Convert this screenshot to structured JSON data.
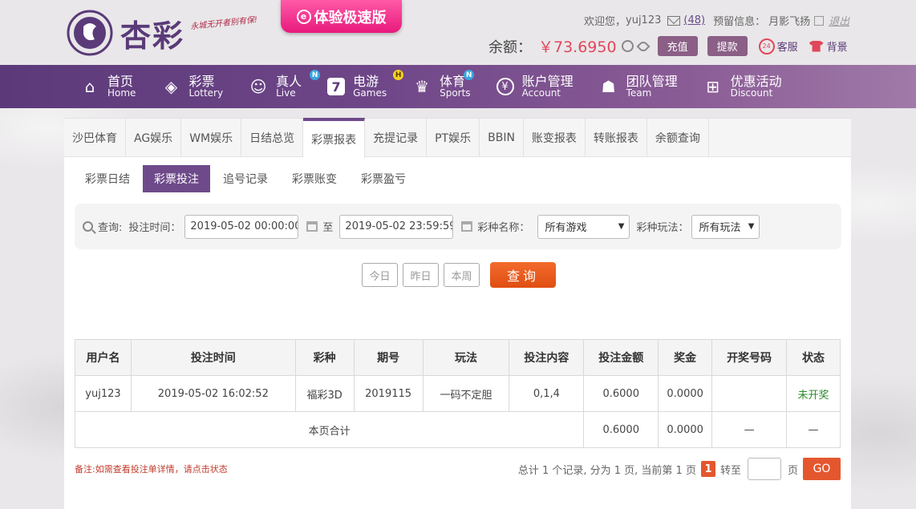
{
  "header": {
    "logo_text": "杏彩",
    "logo_slogan": "永城无开者别有保!",
    "speed_badge": "体验极速版",
    "welcome": "欢迎您，",
    "username": "yuj123",
    "message_count": "(48)",
    "reserve_label": "预留信息：",
    "reserve_value": "月影飞扬",
    "logout": "退出",
    "balance_label": "余额：",
    "balance_value": "￥73.6950",
    "recharge": "充值",
    "withdraw": "提款",
    "service": "客服",
    "background": "背景"
  },
  "nav": [
    {
      "cn": "首页",
      "en": "Home",
      "icon": "home-icon",
      "badge": ""
    },
    {
      "cn": "彩票",
      "en": "Lottery",
      "icon": "lottery-icon",
      "badge": ""
    },
    {
      "cn": "真人",
      "en": "Live",
      "icon": "live-dealer-icon",
      "badge": "N"
    },
    {
      "cn": "电游",
      "en": "Games",
      "icon": "slot-seven-icon",
      "badge": "H"
    },
    {
      "cn": "体育",
      "en": "Sports",
      "icon": "trophy-icon",
      "badge": "N"
    },
    {
      "cn": "账户管理",
      "en": "Account",
      "icon": "yen-coin-icon",
      "badge": ""
    },
    {
      "cn": "团队管理",
      "en": "Team",
      "icon": "team-icon",
      "badge": ""
    },
    {
      "cn": "优惠活动",
      "en": "Discount",
      "icon": "gift-icon",
      "badge": ""
    }
  ],
  "tabs": [
    "沙巴体育",
    "AG娱乐",
    "WM娱乐",
    "日结总览",
    "彩票报表",
    "充提记录",
    "PT娱乐",
    "BBIN",
    "账变报表",
    "转账报表",
    "余额查询"
  ],
  "subtabs": [
    "彩票日结",
    "彩票投注",
    "追号记录",
    "彩票账变",
    "彩票盈亏"
  ],
  "search": {
    "query_label": "查询:",
    "time_label": "投注时间：",
    "start": "2019-05-02 00:00:00",
    "to": "至",
    "end": "2019-05-02 23:59:59",
    "game_label": "彩种名称：",
    "game_value": "所有游戏",
    "play_label": "彩种玩法：",
    "play_value": "所有玩法",
    "today": "今日",
    "yesterday": "昨日",
    "this_week": "本周",
    "search_btn": "查询"
  },
  "table": {
    "headers": [
      "用户名",
      "投注时间",
      "彩种",
      "期号",
      "玩法",
      "投注内容",
      "投注金额",
      "奖金",
      "开奖号码",
      "状态"
    ],
    "row": [
      "yuj123",
      "2019-05-02 16:02:52",
      "福彩3D",
      "2019115",
      "一码不定胆",
      "0,1,4",
      "0.6000",
      "0.0000",
      "",
      "未开奖"
    ],
    "total_label": "本页合计",
    "total_amount": "0.6000",
    "total_bonus": "0.0000",
    "total_dash1": "—",
    "total_dash2": "—"
  },
  "footer": {
    "note": "备注:如需查看投注单详情，请点击状态",
    "pager_text": "总计 1 个记录, 分为 1 页, 当前第 1 页",
    "current_page": "1",
    "goto": "转至",
    "page_unit": "页",
    "go": "GO"
  },
  "colors": {
    "accent": "#6e4a8a",
    "button_orange": "#e4572e",
    "balance_red": "#e2465a"
  }
}
